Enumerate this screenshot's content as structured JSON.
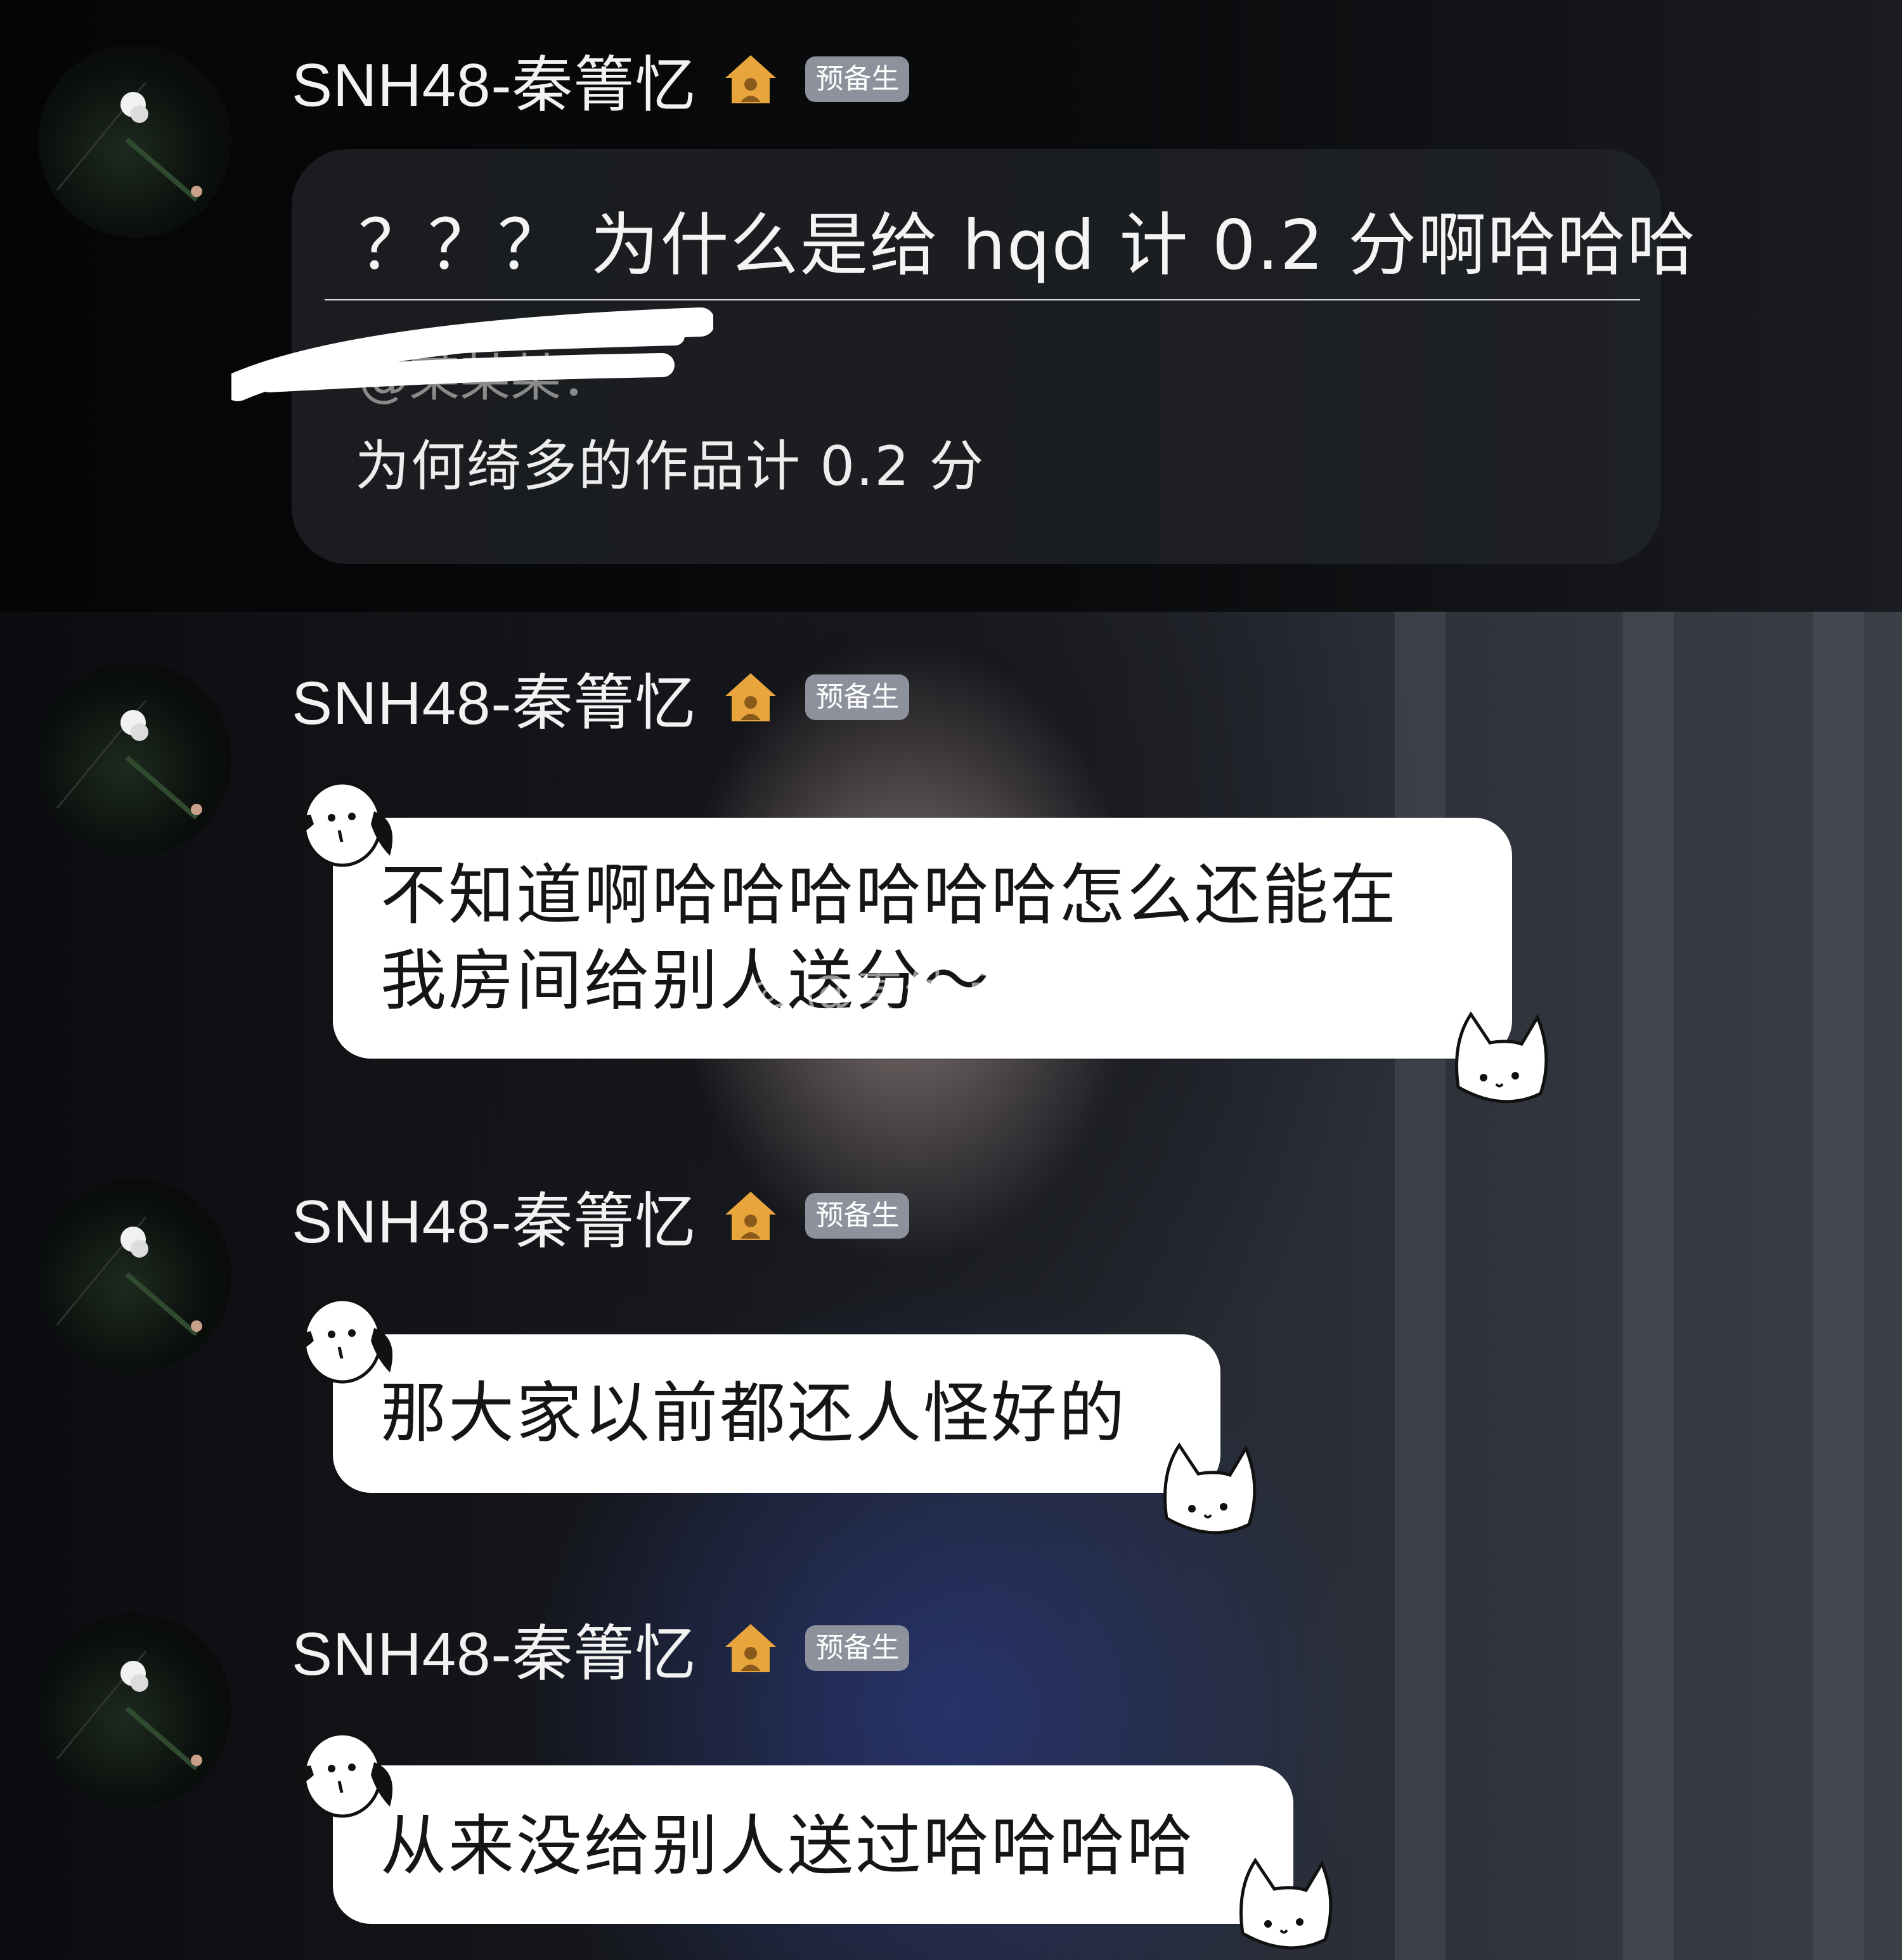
{
  "sender": {
    "name": "SNH48-秦箐忆",
    "badge": "预备生"
  },
  "reply": {
    "text": "？？？ 为什么是给 hqd 计 0.2 分啊哈哈哈",
    "quoted_hidden": "@某某某：",
    "quoted_text": "为何绮多的作品计 0.2 分"
  },
  "messages": [
    {
      "line1": "不知道啊哈哈哈哈哈哈怎么还能在",
      "line2": "我房间给别人送分～"
    },
    {
      "line1": "那大家以前都还人怪好的"
    },
    {
      "line1": "从来没给别人送过哈哈哈哈"
    }
  ],
  "watermark": "@秦纳河大腿子",
  "colors": {
    "badge_bg": "#8c919b",
    "house": "#e7a53c",
    "bubble": "#ffffff"
  }
}
